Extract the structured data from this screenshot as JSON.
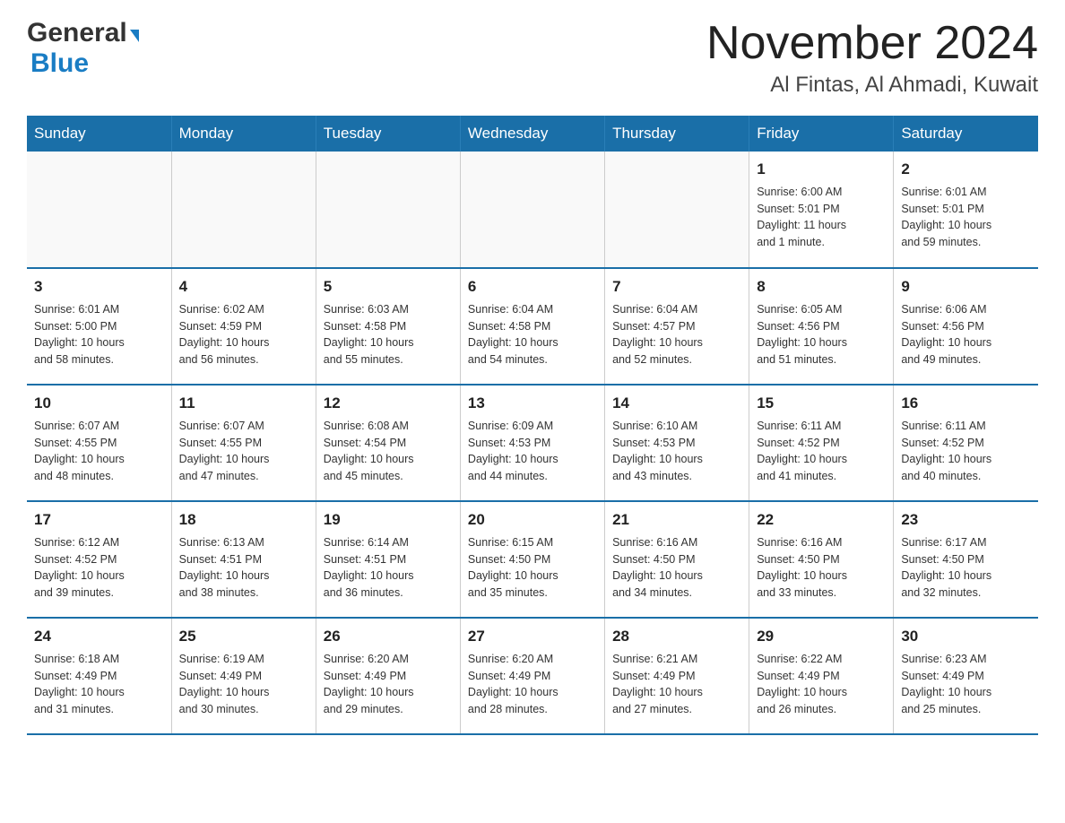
{
  "header": {
    "logo_general": "General",
    "logo_blue": "Blue",
    "month_title": "November 2024",
    "location": "Al Fintas, Al Ahmadi, Kuwait"
  },
  "weekdays": [
    "Sunday",
    "Monday",
    "Tuesday",
    "Wednesday",
    "Thursday",
    "Friday",
    "Saturday"
  ],
  "weeks": [
    [
      {
        "day": "",
        "info": ""
      },
      {
        "day": "",
        "info": ""
      },
      {
        "day": "",
        "info": ""
      },
      {
        "day": "",
        "info": ""
      },
      {
        "day": "",
        "info": ""
      },
      {
        "day": "1",
        "info": "Sunrise: 6:00 AM\nSunset: 5:01 PM\nDaylight: 11 hours\nand 1 minute."
      },
      {
        "day": "2",
        "info": "Sunrise: 6:01 AM\nSunset: 5:01 PM\nDaylight: 10 hours\nand 59 minutes."
      }
    ],
    [
      {
        "day": "3",
        "info": "Sunrise: 6:01 AM\nSunset: 5:00 PM\nDaylight: 10 hours\nand 58 minutes."
      },
      {
        "day": "4",
        "info": "Sunrise: 6:02 AM\nSunset: 4:59 PM\nDaylight: 10 hours\nand 56 minutes."
      },
      {
        "day": "5",
        "info": "Sunrise: 6:03 AM\nSunset: 4:58 PM\nDaylight: 10 hours\nand 55 minutes."
      },
      {
        "day": "6",
        "info": "Sunrise: 6:04 AM\nSunset: 4:58 PM\nDaylight: 10 hours\nand 54 minutes."
      },
      {
        "day": "7",
        "info": "Sunrise: 6:04 AM\nSunset: 4:57 PM\nDaylight: 10 hours\nand 52 minutes."
      },
      {
        "day": "8",
        "info": "Sunrise: 6:05 AM\nSunset: 4:56 PM\nDaylight: 10 hours\nand 51 minutes."
      },
      {
        "day": "9",
        "info": "Sunrise: 6:06 AM\nSunset: 4:56 PM\nDaylight: 10 hours\nand 49 minutes."
      }
    ],
    [
      {
        "day": "10",
        "info": "Sunrise: 6:07 AM\nSunset: 4:55 PM\nDaylight: 10 hours\nand 48 minutes."
      },
      {
        "day": "11",
        "info": "Sunrise: 6:07 AM\nSunset: 4:55 PM\nDaylight: 10 hours\nand 47 minutes."
      },
      {
        "day": "12",
        "info": "Sunrise: 6:08 AM\nSunset: 4:54 PM\nDaylight: 10 hours\nand 45 minutes."
      },
      {
        "day": "13",
        "info": "Sunrise: 6:09 AM\nSunset: 4:53 PM\nDaylight: 10 hours\nand 44 minutes."
      },
      {
        "day": "14",
        "info": "Sunrise: 6:10 AM\nSunset: 4:53 PM\nDaylight: 10 hours\nand 43 minutes."
      },
      {
        "day": "15",
        "info": "Sunrise: 6:11 AM\nSunset: 4:52 PM\nDaylight: 10 hours\nand 41 minutes."
      },
      {
        "day": "16",
        "info": "Sunrise: 6:11 AM\nSunset: 4:52 PM\nDaylight: 10 hours\nand 40 minutes."
      }
    ],
    [
      {
        "day": "17",
        "info": "Sunrise: 6:12 AM\nSunset: 4:52 PM\nDaylight: 10 hours\nand 39 minutes."
      },
      {
        "day": "18",
        "info": "Sunrise: 6:13 AM\nSunset: 4:51 PM\nDaylight: 10 hours\nand 38 minutes."
      },
      {
        "day": "19",
        "info": "Sunrise: 6:14 AM\nSunset: 4:51 PM\nDaylight: 10 hours\nand 36 minutes."
      },
      {
        "day": "20",
        "info": "Sunrise: 6:15 AM\nSunset: 4:50 PM\nDaylight: 10 hours\nand 35 minutes."
      },
      {
        "day": "21",
        "info": "Sunrise: 6:16 AM\nSunset: 4:50 PM\nDaylight: 10 hours\nand 34 minutes."
      },
      {
        "day": "22",
        "info": "Sunrise: 6:16 AM\nSunset: 4:50 PM\nDaylight: 10 hours\nand 33 minutes."
      },
      {
        "day": "23",
        "info": "Sunrise: 6:17 AM\nSunset: 4:50 PM\nDaylight: 10 hours\nand 32 minutes."
      }
    ],
    [
      {
        "day": "24",
        "info": "Sunrise: 6:18 AM\nSunset: 4:49 PM\nDaylight: 10 hours\nand 31 minutes."
      },
      {
        "day": "25",
        "info": "Sunrise: 6:19 AM\nSunset: 4:49 PM\nDaylight: 10 hours\nand 30 minutes."
      },
      {
        "day": "26",
        "info": "Sunrise: 6:20 AM\nSunset: 4:49 PM\nDaylight: 10 hours\nand 29 minutes."
      },
      {
        "day": "27",
        "info": "Sunrise: 6:20 AM\nSunset: 4:49 PM\nDaylight: 10 hours\nand 28 minutes."
      },
      {
        "day": "28",
        "info": "Sunrise: 6:21 AM\nSunset: 4:49 PM\nDaylight: 10 hours\nand 27 minutes."
      },
      {
        "day": "29",
        "info": "Sunrise: 6:22 AM\nSunset: 4:49 PM\nDaylight: 10 hours\nand 26 minutes."
      },
      {
        "day": "30",
        "info": "Sunrise: 6:23 AM\nSunset: 4:49 PM\nDaylight: 10 hours\nand 25 minutes."
      }
    ]
  ]
}
